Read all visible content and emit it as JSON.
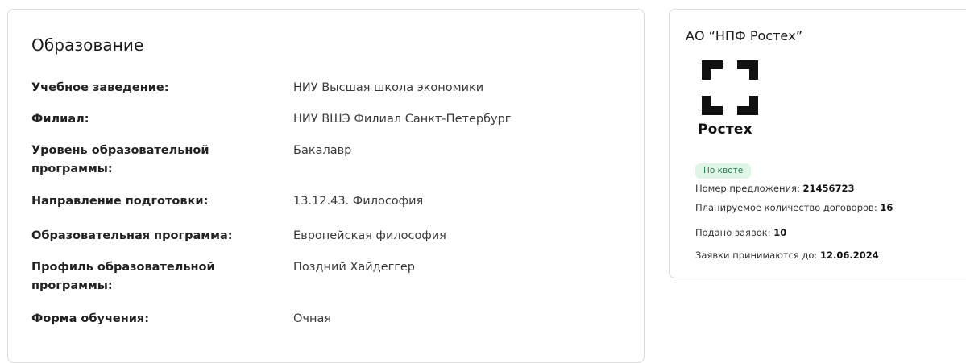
{
  "education": {
    "title": "Образование",
    "rows": [
      {
        "label": "Учебное заведение:",
        "value": "НИУ Высшая школа экономики"
      },
      {
        "label": "Филиал:",
        "value": "НИУ ВШЭ Филиал Санкт-Петербург"
      },
      {
        "label": "Уровень образовательной программы:",
        "value": "Бакалавр"
      },
      {
        "label": "Направление подготовки:",
        "value": "13.12.43. Философия"
      },
      {
        "label": "Образовательная программа:",
        "value": "Европейская философия"
      },
      {
        "label": "Профиль образовательной программы:",
        "value": "Поздний Хайдеггер"
      },
      {
        "label": "Форма обучения:",
        "value": "Очная"
      }
    ]
  },
  "org": {
    "title": "АО “НПФ Ростех”",
    "logo_text": "Ростех",
    "logo_icon": "rostec-logo-icon",
    "badge": "По квоте",
    "badge_color": "#dff5e6",
    "lines": [
      {
        "label": "Номер предложения: ",
        "value": "21456723"
      },
      {
        "label": "Планируемое количество договоров: ",
        "value": "16"
      },
      {
        "label": "Подано заявок: ",
        "value": "10"
      },
      {
        "label": "Заявки принимаются до: ",
        "value": "12.06.2024"
      }
    ]
  }
}
